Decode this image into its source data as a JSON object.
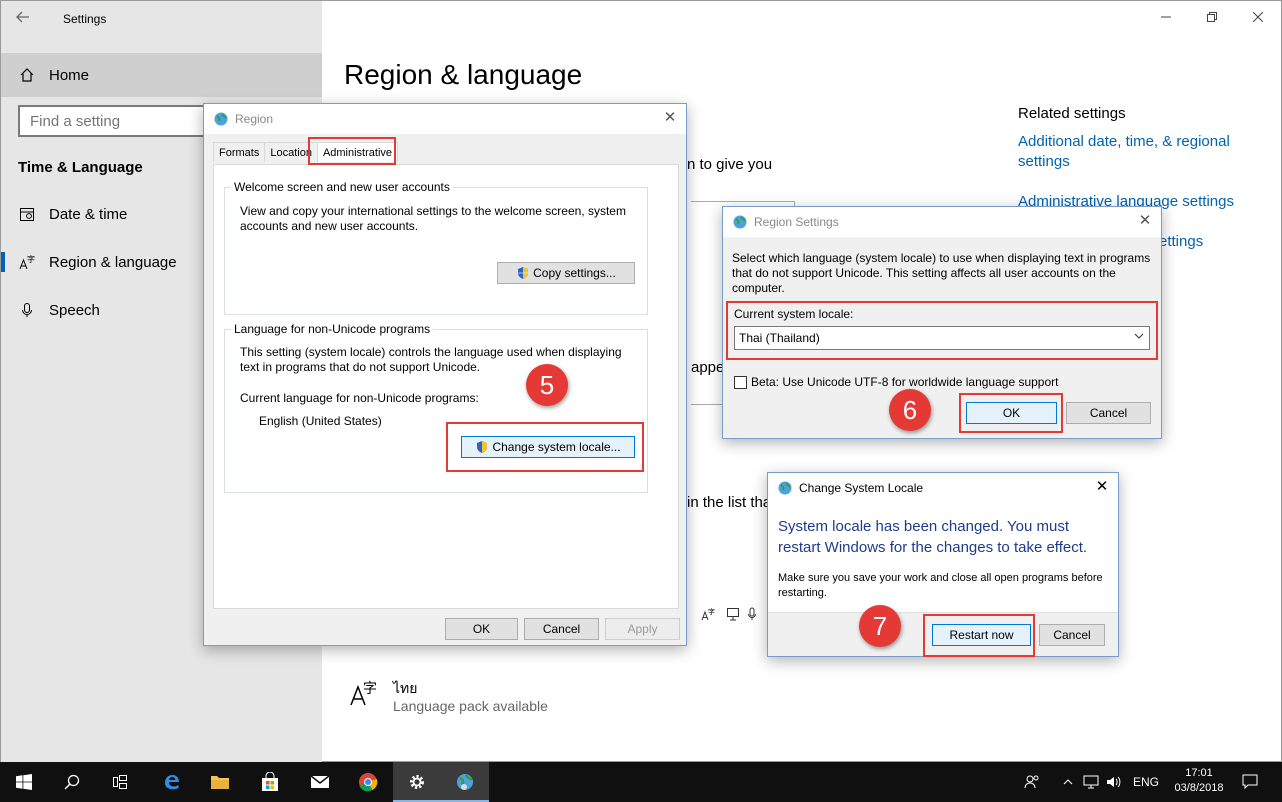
{
  "settings": {
    "title": "Settings",
    "home": "Home",
    "search_placeholder": "Find a setting",
    "section": "Time & Language",
    "nav": [
      {
        "label": "Date & time",
        "icon": "calendar-icon"
      },
      {
        "label": "Region & language",
        "icon": "language-icon"
      },
      {
        "label": "Speech",
        "icon": "microphone-icon"
      }
    ],
    "page_title": "Region & language",
    "partial_text_1": "n to give you",
    "partial_text_2": "appe",
    "partial_text_3": "in the list tha",
    "related": {
      "heading": "Related settings",
      "link1": "Additional date, time, & regional settings",
      "link2": "Administrative language settings",
      "link3": "ettings"
    },
    "language": {
      "name": "ไทย",
      "status": "Language pack available"
    }
  },
  "region_dialog": {
    "title": "Region",
    "tabs": [
      "Formats",
      "Location",
      "Administrative"
    ],
    "group1": {
      "label": "Welcome screen and new user accounts",
      "desc": "View and copy your international settings to the welcome screen, system accounts and new user accounts.",
      "button": "Copy settings..."
    },
    "group2": {
      "label": "Language for non-Unicode programs",
      "desc": "This setting (system locale) controls the language used when displaying text in programs that do not support Unicode.",
      "current_label": "Current language for non-Unicode programs:",
      "current_value": "English (United States)",
      "button": "Change system locale..."
    },
    "ok": "OK",
    "cancel": "Cancel",
    "apply": "Apply"
  },
  "region_settings_dialog": {
    "title": "Region Settings",
    "desc": "Select which language (system locale) to use when displaying text in programs that do not support Unicode. This setting affects all user accounts on the computer.",
    "locale_label": "Current system locale:",
    "locale_value": "Thai (Thailand)",
    "beta_label": "Beta: Use Unicode UTF-8 for worldwide language support",
    "ok": "OK",
    "cancel": "Cancel"
  },
  "change_locale_dialog": {
    "title": "Change System Locale",
    "main": "System locale has been changed. You must restart Windows for the changes to take effect.",
    "sub": "Make sure you save your work and close all open programs before restarting.",
    "restart": "Restart now",
    "cancel": "Cancel"
  },
  "steps": [
    "5",
    "6",
    "7"
  ],
  "taskbar": {
    "lang": "ENG",
    "time": "17:01",
    "date": "03/8/2018"
  },
  "colors": {
    "accent": "#0063b1",
    "annotation_red": "#e53935",
    "taskbar": "#101010"
  }
}
